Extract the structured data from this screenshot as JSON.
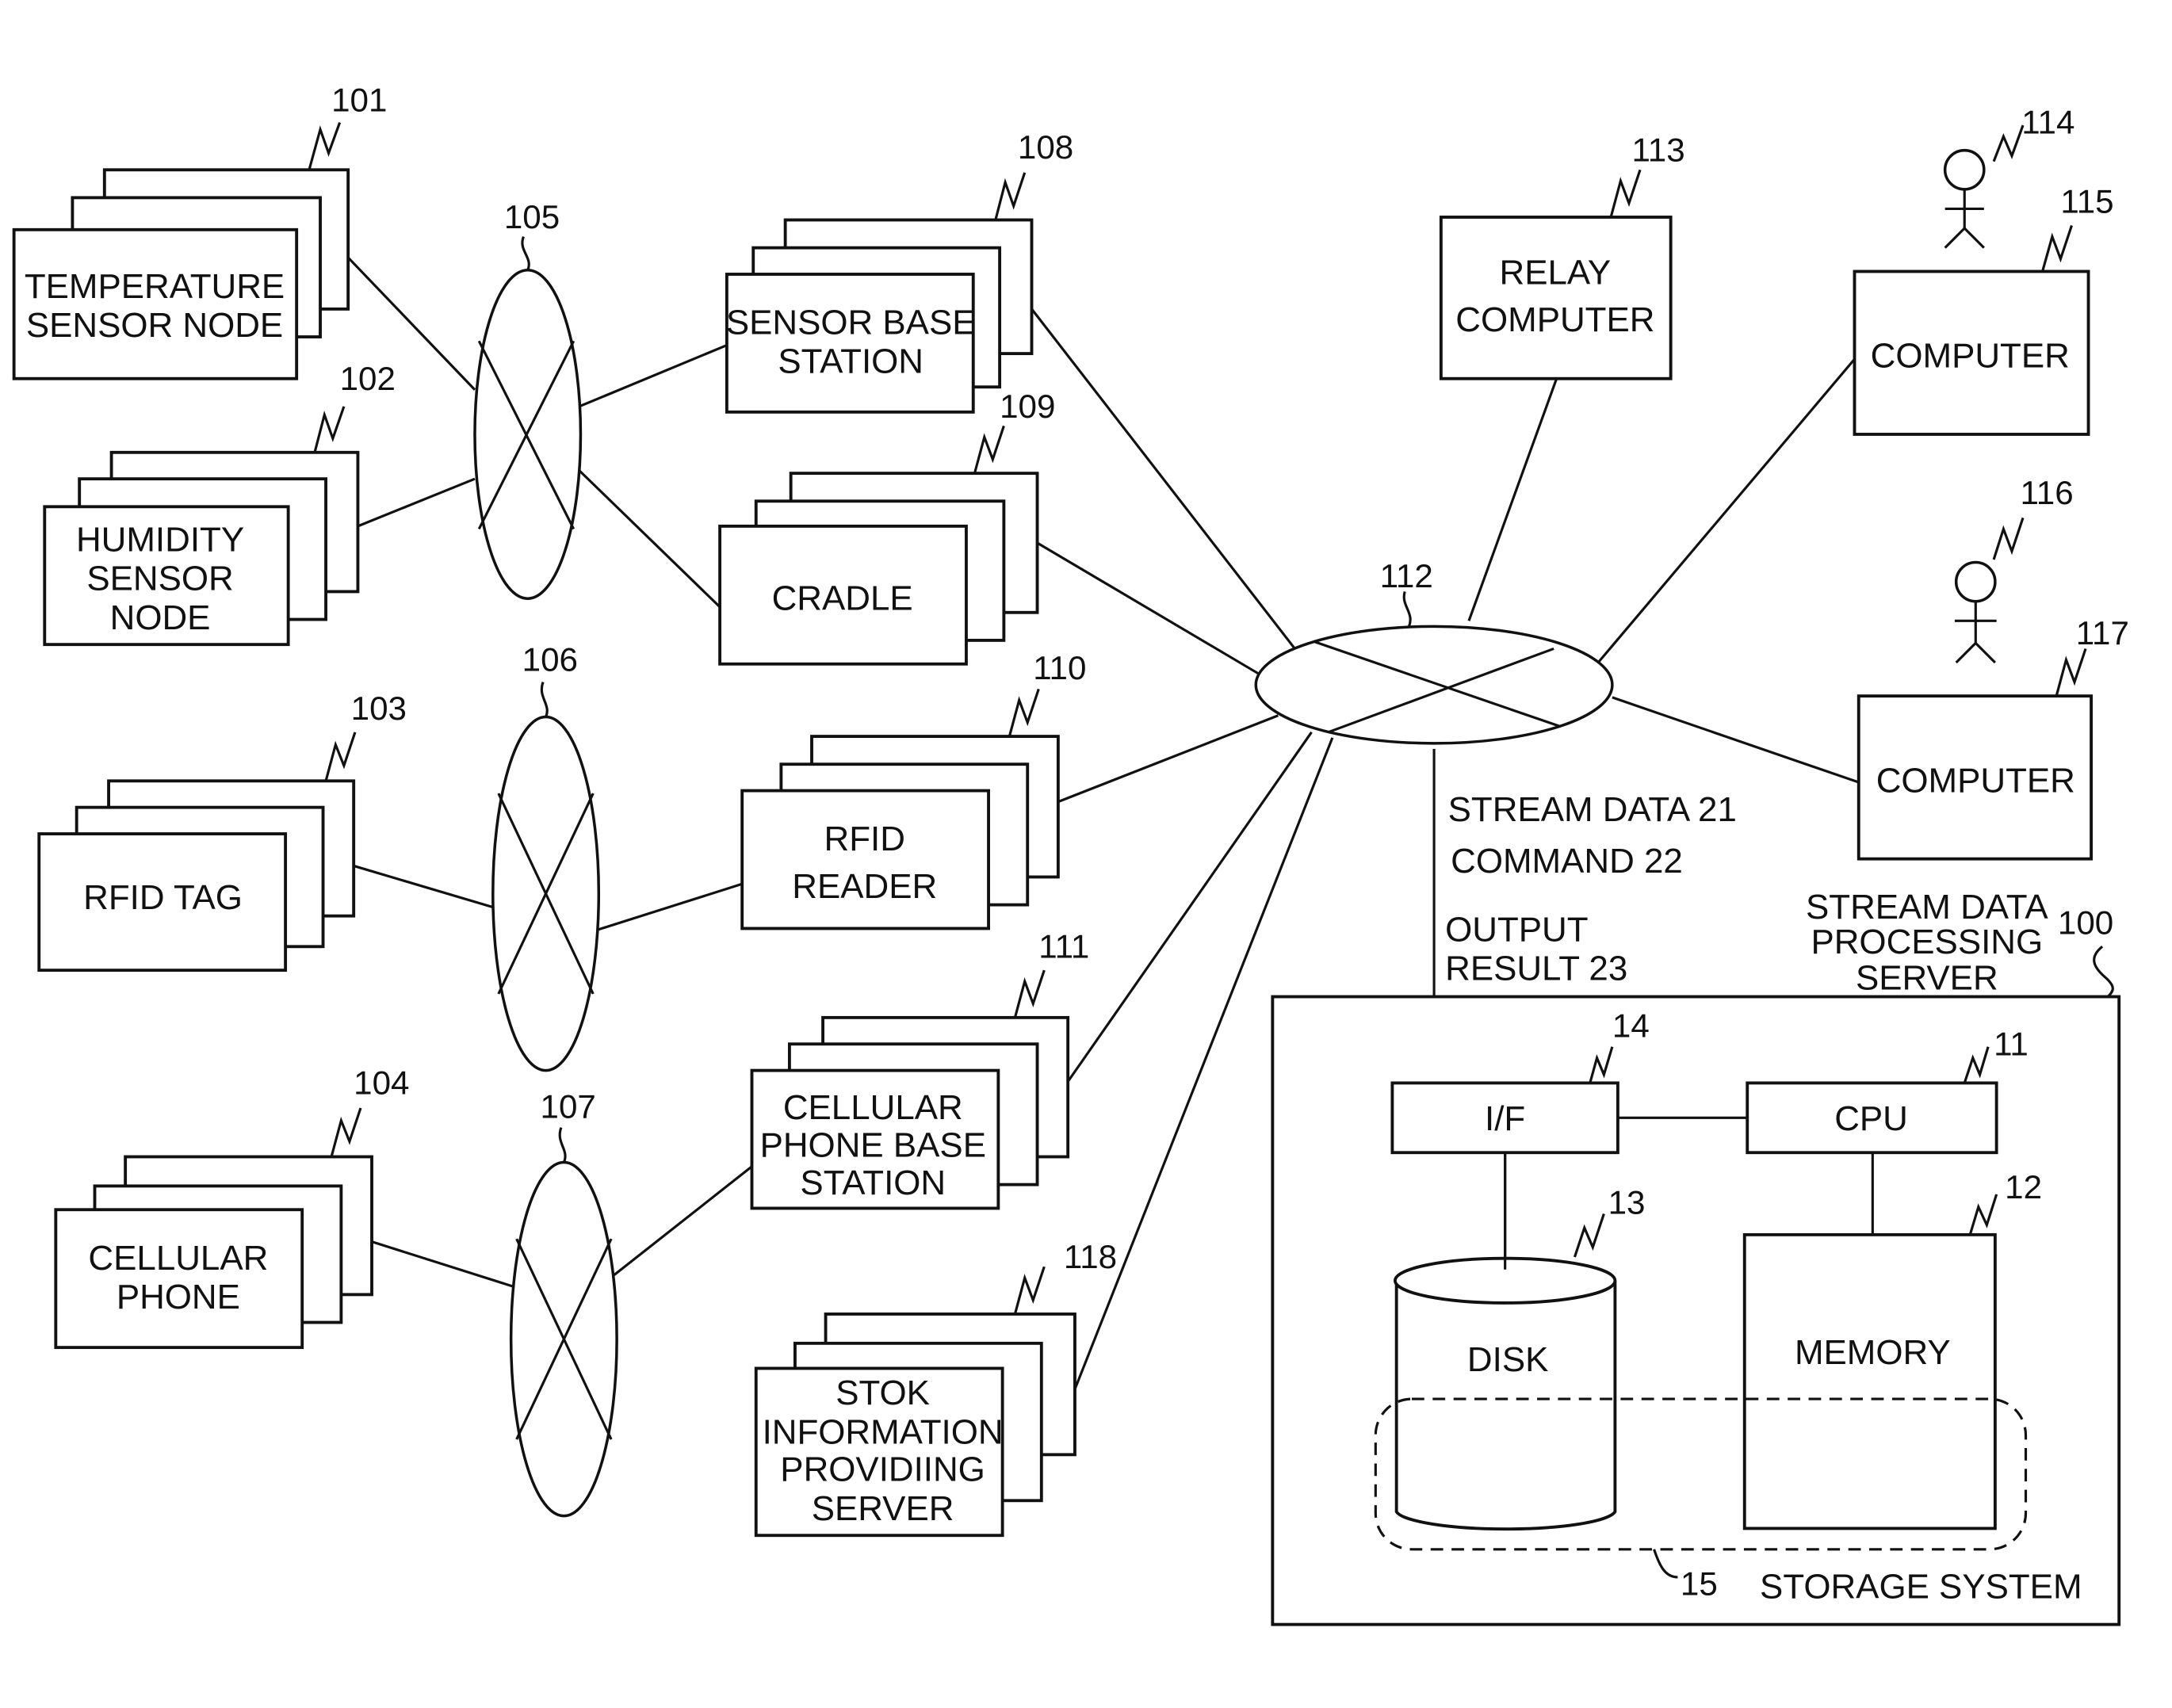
{
  "figure": {
    "nodes": {
      "temperature_sensor": {
        "ref": "101",
        "label": [
          "TEMPERATURE",
          "SENSOR NODE"
        ]
      },
      "humidity_sensor": {
        "ref": "102",
        "label": [
          "HUMIDITY",
          "SENSOR",
          "NODE"
        ]
      },
      "rfid_tag": {
        "ref": "103",
        "label": [
          "RFID TAG"
        ]
      },
      "cellular_phone": {
        "ref": "104",
        "label": [
          "CELLULAR",
          "PHONE"
        ]
      },
      "network_105": {
        "ref": "105"
      },
      "network_106": {
        "ref": "106"
      },
      "network_107": {
        "ref": "107"
      },
      "sensor_base_station": {
        "ref": "108",
        "label": [
          "SENSOR BASE",
          "STATION"
        ]
      },
      "cradle": {
        "ref": "109",
        "label": [
          "CRADLE"
        ]
      },
      "rfid_reader": {
        "ref": "110",
        "label": [
          "RFID",
          "READER"
        ]
      },
      "cellular_base_station": {
        "ref": "111",
        "label": [
          "CELLULAR",
          "PHONE BASE",
          "STATION"
        ]
      },
      "stock_info_server": {
        "ref": "118",
        "label": [
          "STOK",
          "INFORMATION",
          "PROVIDIING",
          "SERVER"
        ]
      },
      "network_112": {
        "ref": "112"
      },
      "relay_computer": {
        "ref": "113",
        "label": [
          "RELAY",
          "COMPUTER"
        ]
      },
      "user_114": {
        "ref": "114"
      },
      "computer_115": {
        "ref": "115",
        "label": [
          "COMPUTER"
        ]
      },
      "user_116": {
        "ref": "116"
      },
      "computer_117": {
        "ref": "117",
        "label": [
          "COMPUTER"
        ]
      }
    },
    "flows": {
      "stream_data": "STREAM DATA  21",
      "command": "COMMAND 22",
      "output_line1": "OUTPUT",
      "output_line2": "RESULT  23"
    },
    "server": {
      "ref": "100",
      "title": [
        "STREAM DATA",
        "PROCESSING",
        "SERVER"
      ],
      "interface": {
        "ref": "14",
        "label": "I/F"
      },
      "cpu": {
        "ref": "11",
        "label": "CPU"
      },
      "disk": {
        "ref": "13",
        "label": "DISK"
      },
      "memory": {
        "ref": "12",
        "label": "MEMORY"
      },
      "storage": {
        "ref": "15",
        "label": "STORAGE SYSTEM"
      }
    }
  }
}
